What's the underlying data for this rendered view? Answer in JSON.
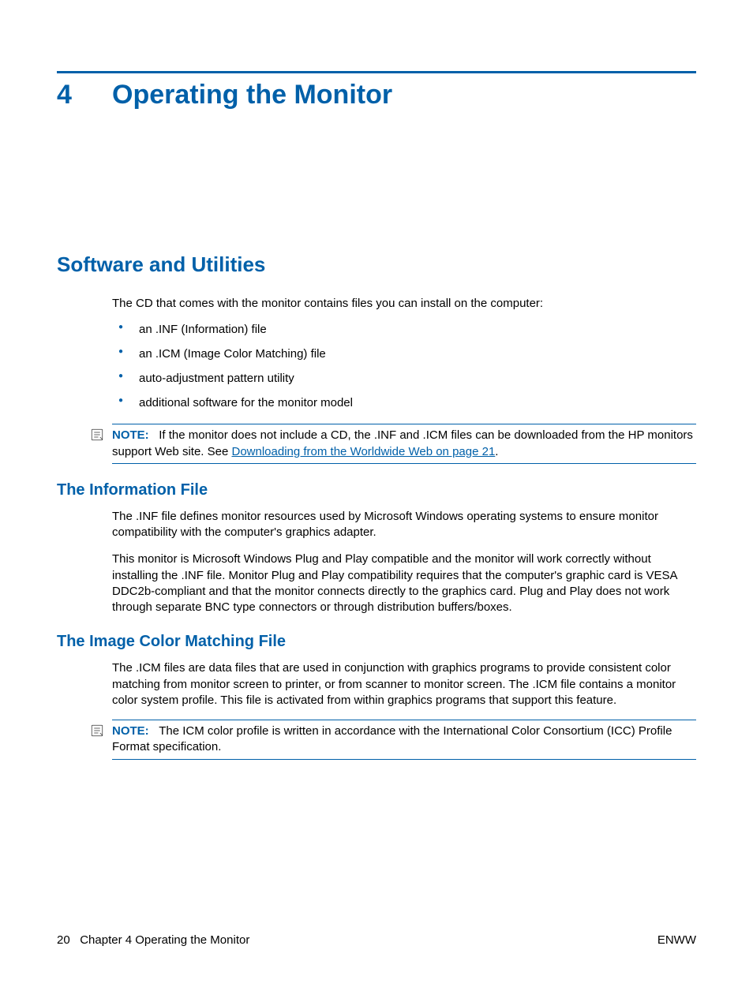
{
  "chapter": {
    "number": "4",
    "title": "Operating the Monitor"
  },
  "section1": {
    "heading": "Software and Utilities",
    "intro": "The CD that comes with the monitor contains files you can install on the computer:",
    "bullets": [
      "an .INF (Information) file",
      "an .ICM (Image Color Matching) file",
      "auto-adjustment pattern utility",
      "additional software for the monitor model"
    ],
    "note": {
      "label": "NOTE:",
      "before_link": "If the monitor does not include a CD, the .INF and .ICM files can be downloaded from the HP monitors support Web site. See ",
      "link": "Downloading from the Worldwide Web on page 21",
      "after_link": "."
    }
  },
  "section2": {
    "heading": "The Information File",
    "p1": "The .INF file defines monitor resources used by Microsoft Windows operating systems to ensure monitor compatibility with the computer's graphics adapter.",
    "p2": "This monitor is Microsoft Windows Plug and Play compatible and the monitor will work correctly without installing the .INF file. Monitor Plug and Play compatibility requires that the computer's graphic card is VESA DDC2b-compliant and that the monitor connects directly to the graphics card. Plug and Play does not work through separate BNC type connectors or through distribution buffers/boxes."
  },
  "section3": {
    "heading": "The Image Color Matching File",
    "p1": "The .ICM files are data files that are used in conjunction with graphics programs to provide consistent color matching from monitor screen to printer, or from scanner to monitor screen. The .ICM file contains a monitor color system profile. This file is activated from within graphics programs that support this feature.",
    "note": {
      "label": "NOTE:",
      "text": "The ICM color profile is written in accordance with the International Color Consortium (ICC) Profile Format specification."
    }
  },
  "footer": {
    "page_num": "20",
    "left": "Chapter 4   Operating the Monitor",
    "right": "ENWW"
  }
}
